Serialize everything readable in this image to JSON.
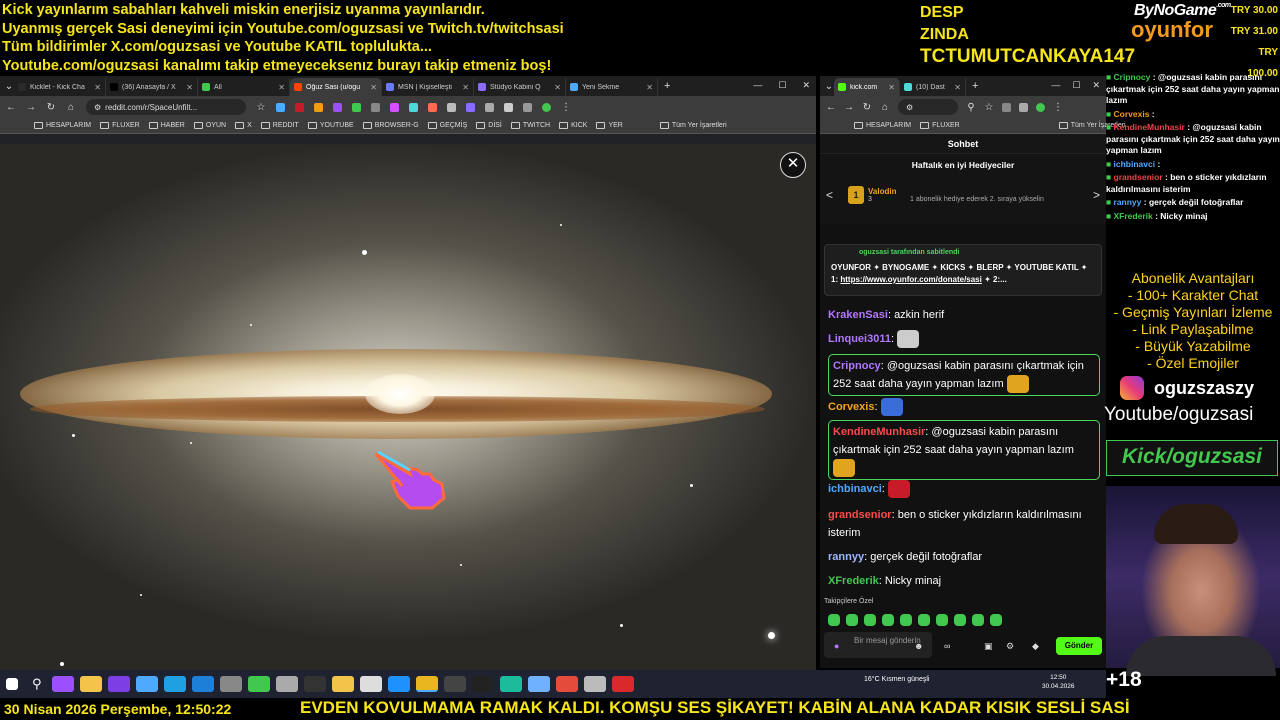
{
  "overlay": {
    "top_lines": [
      "Kick yayınlarım sabahları kahveli miskin enerjisiz uyanma yayınlarıdır.",
      "Uyanmış gerçek Sasi deneyimi için Youtube.com/oguzsasi ve Twitch.tv/twitchsasi",
      "Tüm bildirimler X.com/oguzsasi ve Youtube KATIL toplulukta...",
      "Youtube.com/oguzsasi kanalımı takip etmeyeceksenız burayı takip etmeniz boş!"
    ],
    "donors": [
      "DESP",
      "ZINDA",
      "TCTUMUTCANKAYA147"
    ],
    "brand_top": "ByNoGame",
    "brand_com": ".com",
    "brand_bottom": "oyunfor",
    "prices": [
      "TRY 30.00",
      "TRY 31.00",
      "TRY 100.00"
    ],
    "plus18": "+18",
    "bottom_date": "30 Nisan 2026 Perşembe, 12:50:22",
    "ticker": "EVDEN KOVULMAMA RAMAK KALDI. KOMŞU SES ŞİKAYET! KABİN ALANA KADAR KISIK SESLİ SASİ"
  },
  "left_browser": {
    "tabs": [
      {
        "label": "Kicklet - Kick Cha",
        "color": "#2a2a2a"
      },
      {
        "label": "(36) Anasayfa / X",
        "color": "#000000"
      },
      {
        "label": "All",
        "color": "#43c84f"
      },
      {
        "label": "Oğuz Sasi (u/ogu",
        "color": "#ff4500"
      },
      {
        "label": "MSN | Kişiselleşti",
        "color": "#6b7bff"
      },
      {
        "label": "Stüdyo Kabini Q",
        "color": "#8c6bff"
      },
      {
        "label": "Yeni Sekme",
        "color": "#4fa9ff"
      }
    ],
    "url": "reddit.com/r/SpaceUnfilt...",
    "bookmarks": [
      "HESAPLARIM",
      "FLUXER",
      "HABER",
      "OYUN",
      "X",
      "REDDIT",
      "YOUTUBE",
      "BROWSER-G",
      "GEÇMİŞ",
      "DİSİ",
      "TWITCH",
      "KICK",
      "YER",
      "Tüm Yer İşaretleri"
    ]
  },
  "right_browser": {
    "tabs": [
      "kick.com",
      "(10) Dast"
    ],
    "bookmarks": [
      "HESAPLARIM",
      "FLUXER",
      "Tüm Yer İşaretleri"
    ],
    "chat_title": "Sohbet",
    "gifters_title": "Haftalık en iyi Hediyeciler",
    "top_gifter": {
      "rank": "1",
      "name": "Valodin",
      "count": "3"
    },
    "gifter_note": "1 abonelik hediye ederek 2. sıraya yükselin",
    "pinned_by": "oguzsasi tarafından sabitlendi",
    "pinned_text": "OYUNFOR ✦ BYNOGAME ✦ KICKS ✦ BLERP ✦ YOUTUBE KATIL ✦ 1:",
    "pinned_link": "https://www.oyunfor.com/donate/sasi",
    "pinned_tail": " ✦ 2:...",
    "messages": [
      {
        "user": "KrakenSasi",
        "text": "azkin herif",
        "color": "#b377ff",
        "highlight": false,
        "emote": ""
      },
      {
        "user": "Linquei3011",
        "text": "",
        "color": "#b377ff",
        "highlight": false,
        "emote": "#cccccc"
      },
      {
        "user": "Cripnocy",
        "text": "@oguzsasi kabin parasını çıkartmak için 252 saat daha yayın yapman lazım",
        "color": "#b377ff",
        "highlight": true,
        "emote": "#e0a41f"
      },
      {
        "user": "Corvexis",
        "text": "",
        "color": "#f2a51c",
        "highlight": false,
        "emote": "#3b6dd8"
      },
      {
        "user": "KendineMunhasir",
        "text": "@oguzsasi kabin parasını çıkartmak için 252 saat daha yayın yapman lazım",
        "color": "#ff4a4a",
        "highlight": true,
        "emote": "#e0a41f"
      },
      {
        "user": "ichbinavci",
        "text": "",
        "color": "#4fa9ff",
        "highlight": false,
        "emote": "#c81b2a"
      },
      {
        "user": "grandsenior",
        "text": "ben o sticker yıkdızların kaldırılmasını isterim",
        "color": "#ff4a4a",
        "highlight": false,
        "emote": ""
      },
      {
        "user": "rannyy",
        "text": "gerçek değil fotoğraflar",
        "color": "#9fb7ff",
        "highlight": false,
        "emote": ""
      },
      {
        "user": "XFrederik",
        "text": "Nicky minaj",
        "color": "#43c84f",
        "highlight": false,
        "emote": ""
      }
    ],
    "followers_label": "Takipçilere Özel",
    "input_placeholder": "Bir mesaj gönderin",
    "send_label": "Gönder"
  },
  "mini_chat": [
    {
      "user": "Cripnocy",
      "text": "@oguzsasi kabin parasını çıkartmak için 252 saat daha yayın yapman lazım",
      "cls": "gn"
    },
    {
      "user": "Corvexis",
      "text": "",
      "cls": "yn"
    },
    {
      "user": "KendineMunhasir",
      "text": "@oguzsasi kabin parasını çıkartmak için 252 saat daha yayın yapman lazım",
      "cls": "un"
    },
    {
      "user": "ichbinavci",
      "text": "",
      "cls": "bn"
    },
    {
      "user": "grandsenior",
      "text": "ben o sticker yıkdızların kaldırılmasını isterim",
      "cls": "un"
    },
    {
      "user": "rannyy",
      "text": "gerçek değil fotoğraflar",
      "cls": "bn"
    },
    {
      "user": "XFrederik",
      "text": "Nicky minaj",
      "cls": "gn"
    }
  ],
  "sub_benefits": {
    "title": "Abonelik Avantajları",
    "items": [
      "- 100+ Karakter Chat",
      "- Geçmiş Yayınları İzleme",
      "- Link Paylaşabilme",
      "- Büyük Yazabilme",
      "- Özel Emojiler"
    ]
  },
  "socials": {
    "instagram": "oguzszaszy",
    "youtube": "Youtube/oguzsasi",
    "kick": "Kick/oguzsasi"
  },
  "taskbar": {
    "weather": "16°C  Kısmen güneşli",
    "time": "12:50",
    "date": "30.04.2026"
  }
}
